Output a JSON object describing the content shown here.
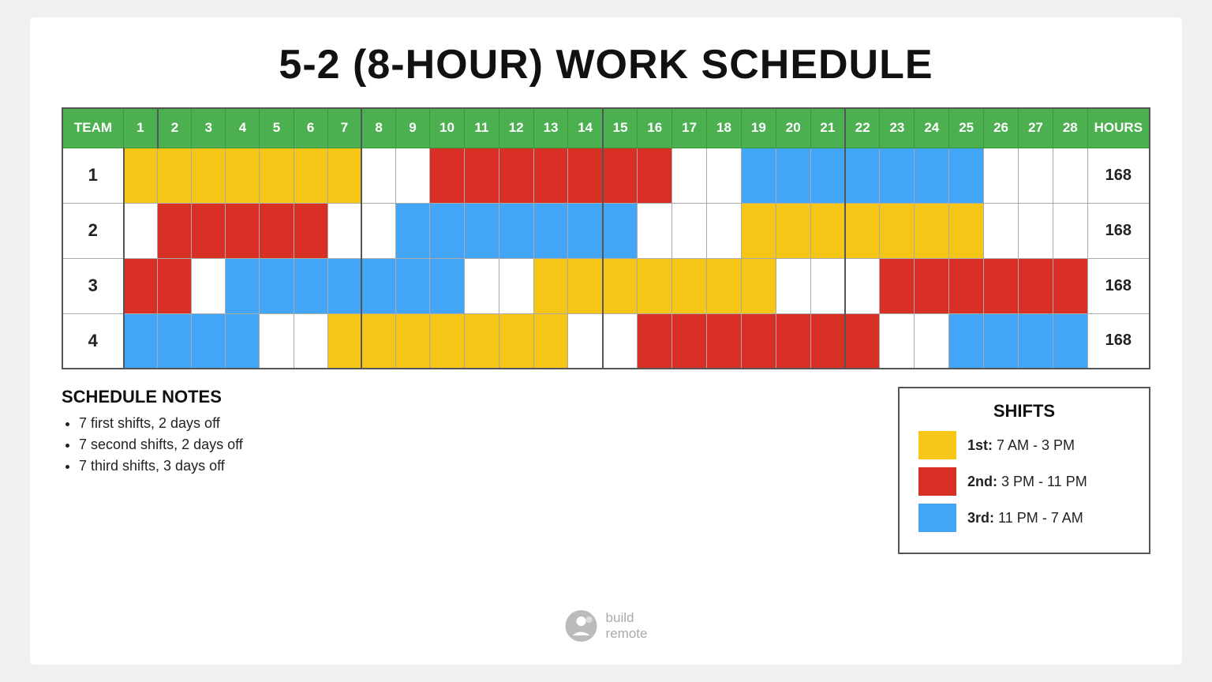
{
  "title": "5-2 (8-HOUR) WORK SCHEDULE",
  "table": {
    "headers": {
      "team": "TEAM",
      "days": [
        1,
        2,
        3,
        4,
        5,
        6,
        7,
        8,
        9,
        10,
        11,
        12,
        13,
        14,
        15,
        16,
        17,
        18,
        19,
        20,
        21,
        22,
        23,
        24,
        25,
        26,
        27,
        28
      ],
      "hours": "HOURS"
    },
    "rows": [
      {
        "team": "1",
        "hours": "168",
        "cells": [
          "1",
          "1",
          "1",
          "1",
          "1",
          "1",
          "1",
          "off",
          "off",
          "2",
          "2",
          "2",
          "2",
          "2",
          "2",
          "2",
          "off",
          "off",
          "3",
          "3",
          "3",
          "3",
          "3",
          "3",
          "3",
          "off",
          "off",
          "off"
        ]
      },
      {
        "team": "2",
        "hours": "168",
        "cells": [
          "off",
          "2",
          "2",
          "2",
          "2",
          "2",
          "off",
          "off",
          "3",
          "3",
          "3",
          "3",
          "3",
          "3",
          "3",
          "off",
          "off",
          "off",
          "1",
          "1",
          "1",
          "1",
          "1",
          "1",
          "1",
          "off",
          "off",
          "off"
        ]
      },
      {
        "team": "3",
        "hours": "168",
        "cells": [
          "2",
          "2",
          "off",
          "3",
          "3",
          "3",
          "3",
          "3",
          "3",
          "3",
          "off",
          "off",
          "1",
          "1",
          "1",
          "1",
          "1",
          "1",
          "1",
          "off",
          "off",
          "off",
          "2",
          "2",
          "2",
          "2",
          "2",
          "2"
        ]
      },
      {
        "team": "4",
        "hours": "168",
        "cells": [
          "3",
          "3",
          "3",
          "3",
          "off",
          "off",
          "1",
          "1",
          "1",
          "1",
          "1",
          "1",
          "1",
          "off",
          "off",
          "2",
          "2",
          "2",
          "2",
          "2",
          "2",
          "2",
          "off",
          "off",
          "3",
          "3",
          "3",
          "3"
        ]
      }
    ]
  },
  "notes": {
    "title": "SCHEDULE NOTES",
    "items": [
      "7 first shifts, 2 days off",
      "7 second shifts, 2 days off",
      "7 third shifts, 3 days off"
    ]
  },
  "legend": {
    "title": "SHIFTS",
    "items": [
      {
        "shift": "1st",
        "time": "7 AM - 3 PM",
        "color": "#f5c518"
      },
      {
        "shift": "2nd",
        "time": "3 PM - 11 PM",
        "color": "#d93025"
      },
      {
        "shift": "3rd",
        "time": "11 PM - 7 AM",
        "color": "#42a5f5"
      }
    ]
  },
  "logo": {
    "line1": "build",
    "line2": "remote"
  }
}
